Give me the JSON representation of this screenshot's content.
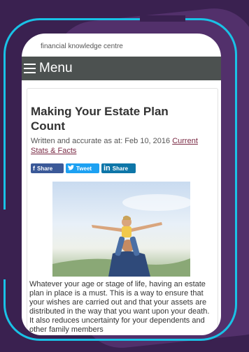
{
  "site": {
    "title": "financial knowledge centre"
  },
  "menu": {
    "label": "Menu",
    "icon": "hamburger-icon"
  },
  "article": {
    "title": "Making Your Estate Plan Count",
    "meta_prefix": "Written and accurate as at: Feb 10, 2016",
    "meta_link": "Current Stats & Facts",
    "body": "Whatever your age or stage of life, having an estate plan in place is a must. This is a way to ensure that your wishes are carried out and that your assets are distributed in the way that you want upon your death.  It also reduces uncertainty for your dependents and other family members"
  },
  "share": {
    "facebook": {
      "label": "Share",
      "icon": "facebook-icon",
      "color": "#3b5998"
    },
    "twitter": {
      "label": "Tweet",
      "icon": "twitter-icon",
      "color": "#1da1f2"
    },
    "linkedin": {
      "label": "Share",
      "icon": "linkedin-icon",
      "color": "#0e76a8"
    }
  },
  "colors": {
    "background": "#3a2150",
    "accent": "#19c2e6",
    "menu_bar": "#4c5150"
  }
}
